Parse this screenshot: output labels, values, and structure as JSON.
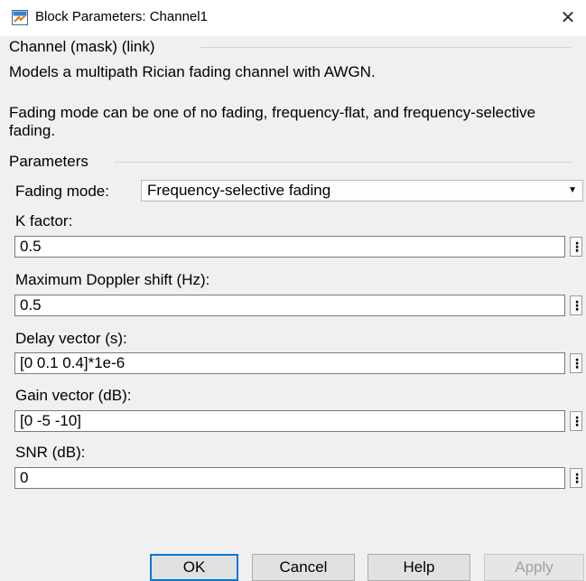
{
  "window": {
    "title": "Block Parameters: Channel1",
    "close_symbol": "✕"
  },
  "block": {
    "header": "Channel (mask) (link)",
    "description1": "Models a multipath Rician fading channel with AWGN.",
    "description2": "Fading mode can be one of no fading, frequency-flat, and frequency-selective fading."
  },
  "parameters": {
    "header": "Parameters",
    "fading_mode": {
      "label": "Fading mode:",
      "value": "Frequency-selective fading"
    },
    "k_factor": {
      "label": "K factor:",
      "value": "0.5"
    },
    "doppler": {
      "label": "Maximum Doppler shift (Hz):",
      "value": "0.5"
    },
    "delay": {
      "label": "Delay vector (s):",
      "value": "[0 0.1 0.4]*1e-6"
    },
    "gain": {
      "label": "Gain vector (dB):",
      "value": "[0 -5 -10]"
    },
    "snr": {
      "label": "SNR (dB):",
      "value": "0"
    }
  },
  "buttons": {
    "ok": "OK",
    "cancel": "Cancel",
    "help": "Help",
    "apply": "Apply"
  },
  "icons": {
    "app": "simulink-block-icon",
    "kebab": "⋮",
    "caret": "▼"
  },
  "colors": {
    "accent": "#0078d7",
    "background": "#f0f0f0"
  }
}
